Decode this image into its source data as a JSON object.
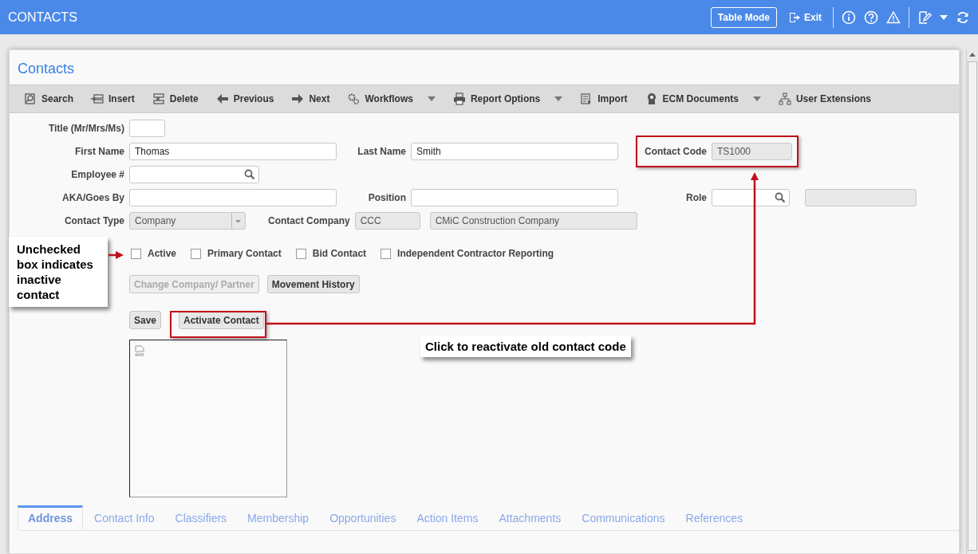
{
  "header": {
    "title": "CONTACTS",
    "table_mode": "Table Mode",
    "exit": "Exit"
  },
  "panel": {
    "title": "Contacts"
  },
  "toolbar": [
    {
      "label": "Search",
      "dropdown": false
    },
    {
      "label": "Insert",
      "dropdown": false
    },
    {
      "label": "Delete",
      "dropdown": false
    },
    {
      "label": "Previous",
      "dropdown": false
    },
    {
      "label": "Next",
      "dropdown": false
    },
    {
      "label": "Workflows",
      "dropdown": true
    },
    {
      "label": "Report Options",
      "dropdown": true
    },
    {
      "label": "Import",
      "dropdown": false
    },
    {
      "label": "ECM Documents",
      "dropdown": true
    },
    {
      "label": "User Extensions",
      "dropdown": false
    }
  ],
  "form": {
    "title_field": {
      "label": "Title (Mr/Mrs/Ms)"
    },
    "first_name": {
      "label": "First Name",
      "value": "Thomas"
    },
    "last_name": {
      "label": "Last Name",
      "value": "Smith"
    },
    "contact_code": {
      "label": "Contact Code",
      "value": "TS1000"
    },
    "employee": {
      "label": "Employee #"
    },
    "aka": {
      "label": "AKA/Goes By"
    },
    "position": {
      "label": "Position"
    },
    "role": {
      "label": "Role"
    },
    "contact_type": {
      "label": "Contact Type",
      "value": "Company"
    },
    "contact_company": {
      "label": "Contact Company",
      "code": "CCC",
      "name": "CMiC Construction Company"
    }
  },
  "checkboxes": [
    {
      "label": "Active",
      "checked": false
    },
    {
      "label": "Primary Contact",
      "checked": false
    },
    {
      "label": "Bid Contact",
      "checked": false
    },
    {
      "label": "Independent Contractor Reporting",
      "checked": false
    }
  ],
  "action_buttons": [
    {
      "label": "Change Company/ Partner",
      "disabled": true
    },
    {
      "label": "Movement History",
      "disabled": false
    }
  ],
  "save_buttons": [
    {
      "label": "Save",
      "disabled": false
    },
    {
      "label": "Activate Contact",
      "disabled": false
    }
  ],
  "callouts": [
    {
      "text": "Unchecked box indicates inactive contact"
    },
    {
      "text": "Click to reactivate old contact code"
    }
  ],
  "tabs": [
    {
      "label": "Address",
      "selected": true
    },
    {
      "label": "Contact Info",
      "selected": false
    },
    {
      "label": "Classifiers",
      "selected": false
    },
    {
      "label": "Membership",
      "selected": false
    },
    {
      "label": "Opportunities",
      "selected": false
    },
    {
      "label": "Action Items",
      "selected": false
    },
    {
      "label": "Attachments",
      "selected": false
    },
    {
      "label": "Communications",
      "selected": false
    },
    {
      "label": "References",
      "selected": false
    }
  ]
}
